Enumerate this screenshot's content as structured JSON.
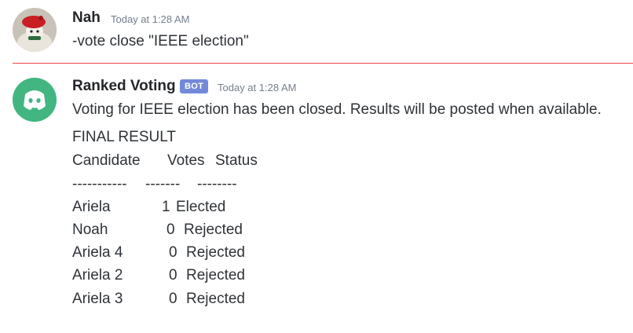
{
  "messages": [
    {
      "author": "Nah",
      "timestamp": "Today at 1:28 AM",
      "text": "-vote close \"IEEE election\""
    },
    {
      "author": "Ranked Voting",
      "tag": "BOT",
      "timestamp": "Today at 1:28 AM",
      "text": "Voting for IEEE election has been closed. Results will be posted when available.",
      "result_title": "FINAL RESULT",
      "table": {
        "headers": [
          "Candidate",
          "Votes",
          "Status"
        ],
        "divider": [
          "-----------",
          "-------",
          "--------"
        ],
        "rows": [
          [
            "Ariela",
            "1",
            "Elected"
          ],
          [
            "Noah",
            "0",
            "Rejected"
          ],
          [
            "Ariela 4",
            "0",
            "Rejected"
          ],
          [
            "Ariela 2",
            "0",
            "Rejected"
          ],
          [
            "Ariela 3",
            "0",
            "Rejected"
          ]
        ]
      }
    }
  ],
  "icons": {
    "user_avatar": "user-avatar-icon",
    "bot_avatar": "discord-logo-icon"
  },
  "colors": {
    "separator": "#f04747",
    "bot_tag": "#7289da",
    "bot_avatar_bg": "#43b581",
    "timestamp": "#747f8d"
  }
}
